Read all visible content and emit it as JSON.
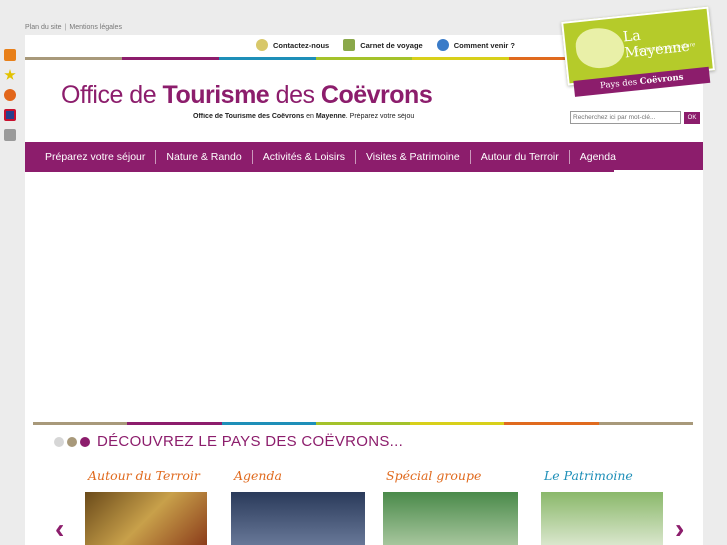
{
  "top_links": [
    "Plan du site",
    "Mentions légales"
  ],
  "sidebar_icons": [
    {
      "name": "rss-icon",
      "color": "#e8801a"
    },
    {
      "name": "star-icon",
      "color": "#e2c200"
    },
    {
      "name": "add-icon",
      "color": "#e2661a"
    },
    {
      "name": "english-flag-icon",
      "color": "#2a3f8c"
    },
    {
      "name": "print-icon",
      "color": "#9a9a9a"
    }
  ],
  "header_links": [
    {
      "label": "Contactez-nous",
      "icon": "contact-icon",
      "color": "#d8c86a"
    },
    {
      "label": "Carnet de voyage",
      "icon": "notebook-icon",
      "color": "#8aa84a"
    },
    {
      "label": "Comment venir ?",
      "icon": "globe-icon",
      "color": "#3a7bc8"
    }
  ],
  "brand": {
    "part1": "Office de ",
    "part2": "Tourisme",
    "part3": " des ",
    "part4": "Coëvrons"
  },
  "tagline": {
    "bold1": "Office de Tourisme des Coëvrons",
    "text1": " en ",
    "bold2": "Mayenne",
    "text2": ". Préparez votre séjou"
  },
  "search": {
    "placeholder": "Recherchez ici par mot-clé...",
    "button": "OK"
  },
  "nav": [
    "Préparez votre séjour",
    "Nature & Rando",
    "Activités & Loisirs",
    "Visites & Patrimoine",
    "Autour du Terroir",
    "Agenda"
  ],
  "colors": {
    "brand": "#8c1d6c",
    "stripe": [
      "#a8997a",
      "#8c1d6c",
      "#1e8fb8",
      "#a4c22a",
      "#d8d01a",
      "#e06a1e",
      "#a8997a"
    ]
  },
  "discover": {
    "title": "DÉCOUVREZ LE PAYS DES COËVRONS...",
    "dot_colors": [
      "#d6d6d6",
      "#a8997a",
      "#8c1d6c"
    ]
  },
  "arrows": {
    "prev": "‹",
    "next": "›"
  },
  "cards": [
    {
      "title": "Autour du Terroir",
      "color": "#e06a1e",
      "photo": "#8a6a2a"
    },
    {
      "title": "Agenda",
      "color": "#e06a1e",
      "photo": "#4a5a78"
    },
    {
      "title": "Spécial groupe",
      "color": "#e06a1e",
      "photo": "#6a8a5a"
    },
    {
      "title": "Le Patrimoine",
      "color": "#1e8fb8",
      "photo": "#6a9a4a"
    }
  ],
  "logo": {
    "title": "La Mayenne",
    "subtitle": "Enchantée par nature",
    "band_prefix": "Pays des ",
    "band_bold": "Coëvrons"
  }
}
